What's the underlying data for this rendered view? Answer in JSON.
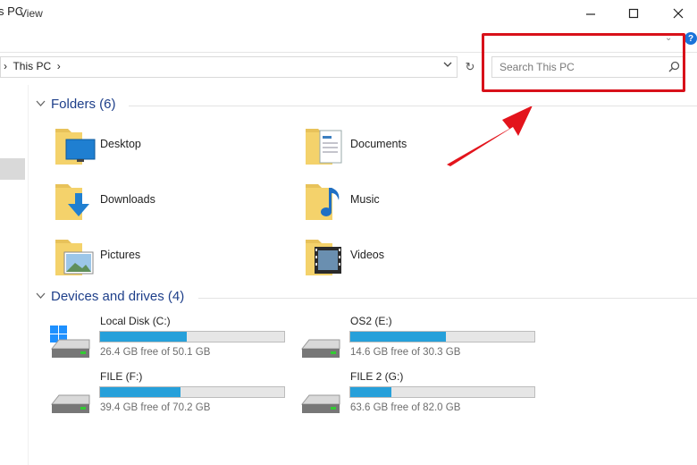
{
  "window": {
    "title": "s PC"
  },
  "ribbon": {
    "view_tab": "View"
  },
  "address": {
    "path": "›  This PC  ›"
  },
  "search": {
    "placeholder": "Search This PC"
  },
  "folders": {
    "header": "Folders (6)",
    "items": [
      {
        "label": "Desktop",
        "icon": "desktop-folder-icon"
      },
      {
        "label": "Documents",
        "icon": "documents-folder-icon"
      },
      {
        "label": "Downloads",
        "icon": "downloads-folder-icon"
      },
      {
        "label": "Music",
        "icon": "music-folder-icon"
      },
      {
        "label": "Pictures",
        "icon": "pictures-folder-icon"
      },
      {
        "label": "Videos",
        "icon": "videos-folder-icon"
      }
    ]
  },
  "drives": {
    "header": "Devices and drives (4)",
    "items": [
      {
        "label": "Local Disk (C:)",
        "free": "26.4 GB free of 50.1 GB",
        "used_fraction": 0.473
      },
      {
        "label": "OS2 (E:)",
        "free": "14.6 GB free of 30.3 GB",
        "used_fraction": 0.518
      },
      {
        "label": "FILE (F:)",
        "free": "39.4 GB free of 70.2 GB",
        "used_fraction": 0.439
      },
      {
        "label": "FILE 2 (G:)",
        "free": "63.6 GB free of 82.0 GB",
        "used_fraction": 0.224
      }
    ]
  },
  "colors": {
    "accent": "#26a0da",
    "highlight": "#d8111a",
    "group_header": "#1e3f8a"
  }
}
